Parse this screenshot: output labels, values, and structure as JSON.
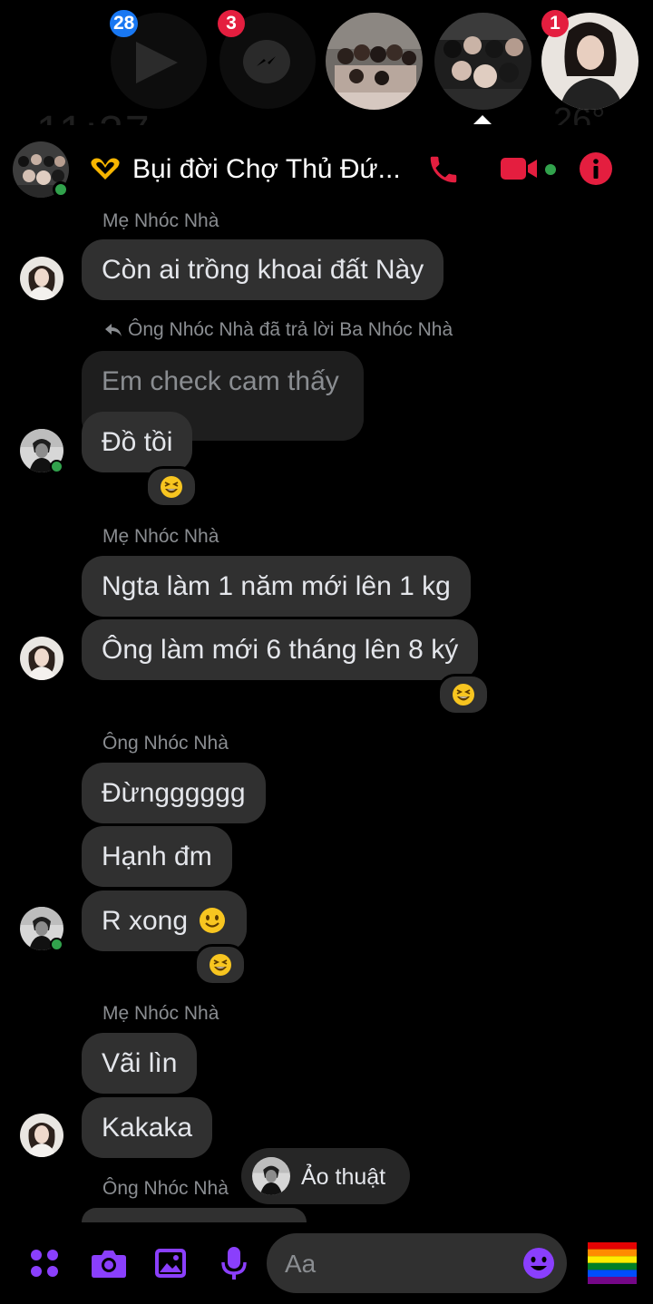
{
  "chat_heads": {
    "badges": {
      "video_app": "28",
      "messenger": "3",
      "person": "1"
    },
    "colors": {
      "blue_badge": "#1877f2",
      "red_badge": "#e41e3f"
    }
  },
  "header": {
    "title": "Bụi đời Chợ Thủ Đứ...",
    "accent": "#e41e3f"
  },
  "messages": [
    {
      "sender": "Mẹ Nhóc Nhà",
      "bubbles": [
        "Còn ai trồng khoai đất Này"
      ]
    },
    {
      "reply_note": "Ông Nhóc Nhà đã trả lời Ba Nhóc Nhà",
      "quoted": "Em check cam thấy",
      "bubbles": [
        "Đồ tồi"
      ],
      "reaction": "laughing-face"
    },
    {
      "sender": "Mẹ Nhóc Nhà",
      "bubbles": [
        "Ngta làm 1 năm mới lên 1 kg",
        "Ông làm mới 6 tháng lên 8 ký"
      ],
      "reaction": "laughing-face"
    },
    {
      "sender": "Ông Nhóc Nhà",
      "bubbles": [
        "Đừngggggg",
        "Hạnh đm",
        "R xong"
      ],
      "reaction": "laughing-face"
    },
    {
      "sender": "Mẹ Nhóc Nhà",
      "bubbles": [
        "Vãi lìn",
        "Kakaka"
      ]
    },
    {
      "sender": "Ông Nhóc Nhà"
    }
  ],
  "toast": {
    "label": "Ảo thuật"
  },
  "composer": {
    "placeholder": "Aa",
    "accent": "#8a3ffc"
  }
}
